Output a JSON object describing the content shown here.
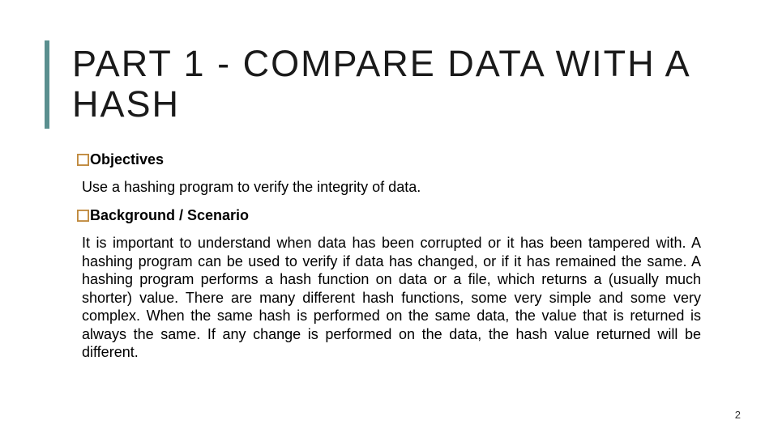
{
  "title": "PART 1 - COMPARE DATA WITH A HASH",
  "sections": [
    {
      "heading": "Objectives",
      "body": "Use a hashing program to verify the integrity of data.",
      "justified": false
    },
    {
      "heading": "Background / Scenario",
      "body": "It is important to understand when data has been corrupted or it has been tampered with. A hashing program can be used to verify if data has changed, or if it has remained the same. A hashing program performs a hash function on data or a file, which returns a (usually much shorter) value. There are many different hash functions, some very simple and some very complex. When the same hash is performed on the same data, the value that is returned is always the same. If any change is performed on the data, the hash value returned will be different.",
      "justified": true
    }
  ],
  "page_number": "2",
  "accent_color": "#5a8f8f",
  "bullet_color": "#c08a3e"
}
